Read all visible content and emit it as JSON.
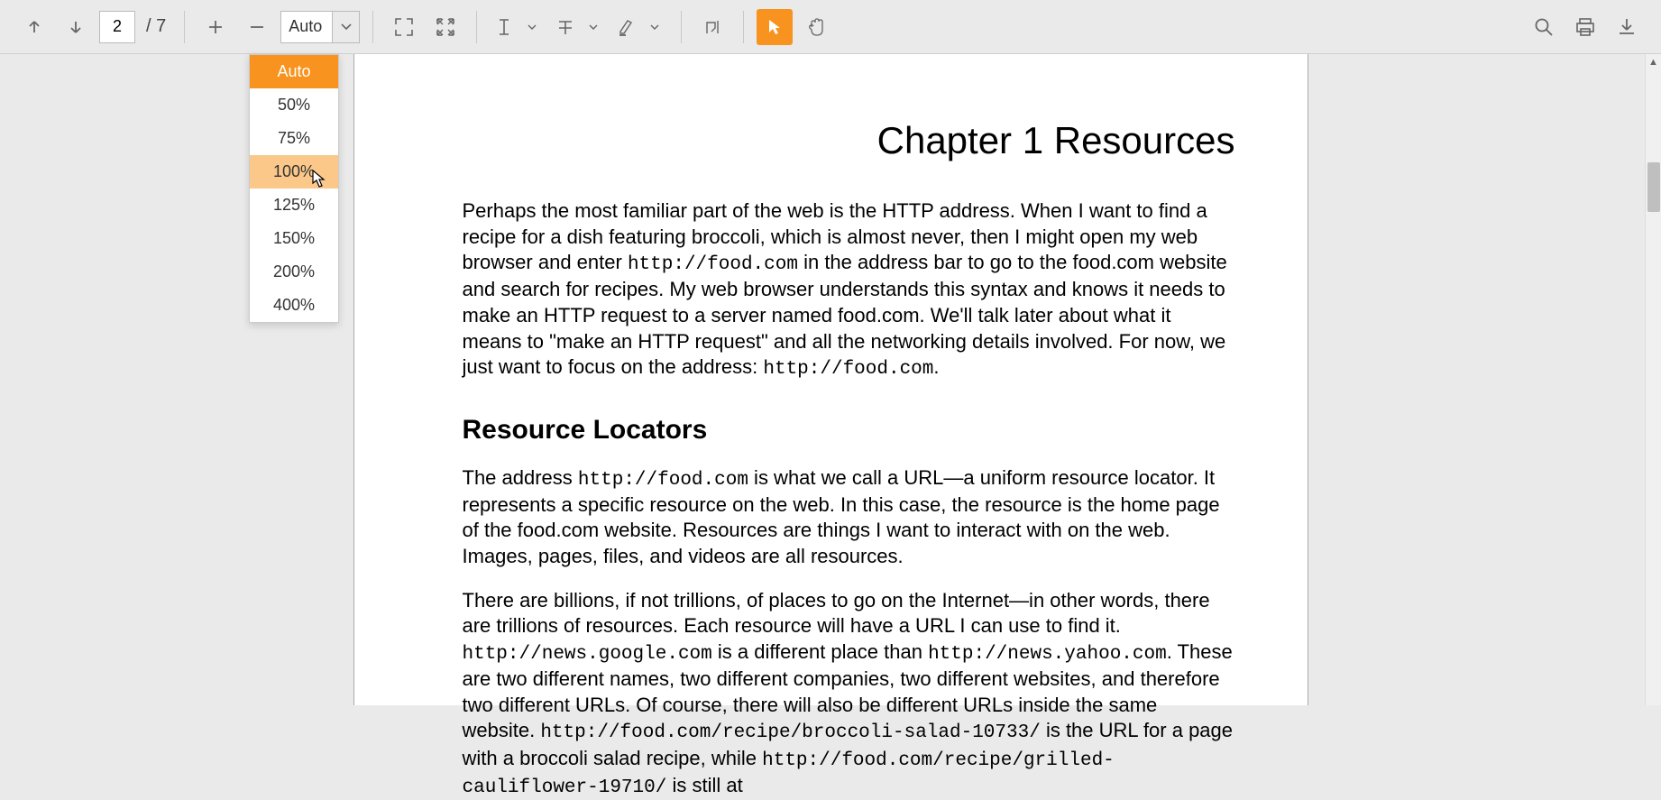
{
  "toolbar": {
    "page_current": "2",
    "page_total": "/ 7",
    "zoom_value": "Auto",
    "zoom_options": [
      "Auto",
      "50%",
      "75%",
      "100%",
      "125%",
      "150%",
      "200%",
      "400%"
    ],
    "zoom_selected_index": 0,
    "zoom_hover_index": 3
  },
  "document": {
    "chapter_title": "Chapter 1  Resources",
    "para1_a": "Perhaps the most familiar part of the web is the HTTP address. When I want to find a recipe for a dish featuring broccoli, which is almost never, then I might open my web browser and enter ",
    "para1_code1": "http://food.com",
    "para1_b": " in the address bar to go to the food.com website and search for recipes. My web browser understands this syntax and knows it needs to make an HTTP request to a server named food.com. We'll talk later about what it means to \"make an HTTP request\" and all the networking details involved. For now, we just want to focus on the address: ",
    "para1_code2": "http://food.com",
    "para1_c": ".",
    "heading2": "Resource Locators",
    "para2_a": "The address ",
    "para2_code1": "http://food.com",
    "para2_b": " is what we call a URL—a uniform resource locator. It represents a specific resource on the web. In this case, the resource is the home page of the food.com website. Resources are things I want to interact with on the web. Images, pages, files, and videos are all resources.",
    "para3_a": "There are billions, if not trillions, of places to go on the Internet—in other words, there are trillions of resources. Each resource will have a URL I can use to find it. ",
    "para3_code1": "http://news.google.com",
    "para3_b": " is a different place than ",
    "para3_code2": "http://news.yahoo.com",
    "para3_c": ". These are two different names, two different companies, two different websites, and therefore two different URLs. Of course, there will also be different URLs inside the same website. ",
    "para3_code3": "http://food.com/recipe/broccoli-salad-10733/",
    "para3_d": " is the URL for a page with a broccoli salad recipe, while ",
    "para3_code4": "http://food.com/recipe/grilled-cauliflower-19710/",
    "para3_e": " is still at"
  }
}
